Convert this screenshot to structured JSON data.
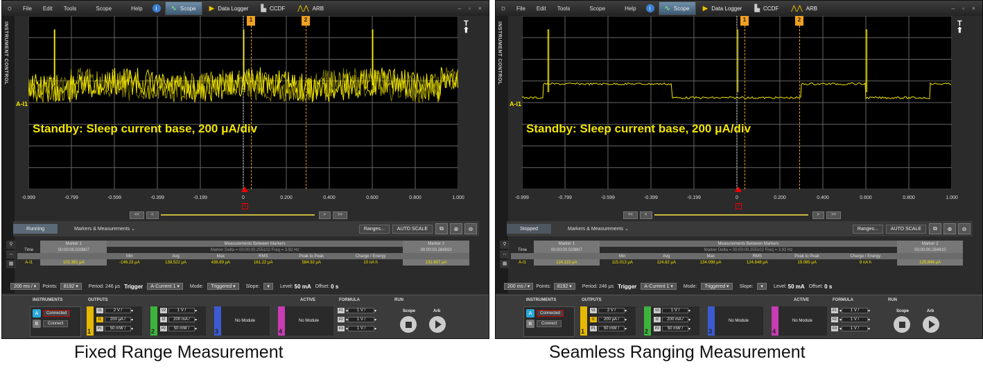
{
  "common": {
    "menu": [
      "File",
      "Edit",
      "Tools",
      "Scope",
      "Help"
    ],
    "tabs": [
      {
        "label": "Scope",
        "icon": "scope-icon"
      },
      {
        "label": "Data Logger",
        "icon": "datalogger-icon"
      },
      {
        "label": "CCDF",
        "icon": "ccdf-icon"
      },
      {
        "label": "ARB",
        "icon": "arb-icon"
      }
    ],
    "sidebar_label": "INSTRUMENT CONTROL",
    "trigger_arrow_label": "T",
    "channel_label": "A-I1",
    "annotation": "Standby:  Sleep current base, 200 μA/div",
    "x_ticks": [
      "-0.999",
      "-0.799",
      "-0.599",
      "-0.399",
      "-0.199",
      "0",
      "0.200",
      "0.400",
      "0.600",
      "0.800",
      "1.000"
    ],
    "marker1": "1",
    "marker2": "2",
    "nav_buttons": [
      "<<",
      "<",
      ">",
      ">>"
    ],
    "zero_mark": "0",
    "markers_label": "Markers & Measurements",
    "ranges_label": "Ranges...",
    "autoscale_label": "AUTO SCALE",
    "table": {
      "marker1_header": "Marker 1",
      "marker1_time": "00:00:00.029807",
      "between_header": "Measurements Between Markers",
      "delta_text": "Marker Delta = 00:00:00.255102   Freq = 3.92 Hz",
      "marker2_header": "Marker 2",
      "marker2_time": "00:00:00.284910",
      "time_label": "Time",
      "col_headers": [
        "Min",
        "Avg",
        "Max",
        "RMS",
        "Peak to Peak",
        "Charge / Energy"
      ],
      "row_label": "A-I1"
    },
    "controls": {
      "timebase": "200 ms /",
      "points_label": "Points:",
      "points": "8192",
      "period_label": "Period:",
      "period": "246 μs",
      "trigger_label": "Trigger",
      "trigger_source": "A-Current 1",
      "mode_label": "Mode:",
      "mode": "Triggered",
      "slope_label": "Slope:",
      "level_label": "Level:",
      "level": "50 mA",
      "offset_label": "Offset:",
      "offset": "0 s"
    },
    "bottom": {
      "instruments_title": "INSTRUMENTS",
      "outputs_title": "OUTPUTS",
      "active_title": "ACTIVE",
      "formula_title": "FORMULA",
      "run_title": "RUN",
      "inst_a": "A",
      "inst_a_status": "Connected",
      "inst_b": "B",
      "inst_b_status": "Connect",
      "out1": {
        "num": "1",
        "v_tag": "V1",
        "v_val": "2 V /",
        "i_tag": "I1",
        "i_val": "200 μA /",
        "p_tag": "P1",
        "p_val": "50 mW /"
      },
      "out2": {
        "num": "2",
        "v_tag": "V2",
        "v_val": "1 V /",
        "i_tag": "I2",
        "i_val": "200 mA /",
        "p_tag": "P2",
        "p_val": "50 mW /"
      },
      "out3": {
        "num": "3",
        "text": "No Module"
      },
      "out4": {
        "num": "4",
        "text": "No Module"
      },
      "formulas": [
        {
          "tag": "F1",
          "val": "1 V /"
        },
        {
          "tag": "F2",
          "val": "1 V /"
        },
        {
          "tag": "F3",
          "val": "1 V /"
        }
      ],
      "scope_label": "Scope",
      "arb_label": "Arb"
    },
    "colors": {
      "trace": "#f2e600",
      "marker": "#f0a020",
      "out1": "#e6b800",
      "out2": "#3cb43c",
      "out3": "#3c5ad2",
      "out4": "#c83cb4"
    }
  },
  "left": {
    "caption": "Fixed Range Measurement",
    "status": "Running",
    "values": [
      "102.361 μA",
      "-146.23 μA",
      "138.522 μA",
      "438.69 μA",
      "161.22 μA",
      "584.92 μA",
      "10 nA h",
      "131.607 μA"
    ]
  },
  "right": {
    "caption": "Seamless Ranging Measurement",
    "status": "Stopped",
    "values": [
      "124.115 μA",
      "115.013 μA",
      "124.82 μA",
      "134.098 μA",
      "124.848 μA",
      "19.085 μA",
      "9 nA h",
      "125.846 μA"
    ]
  }
}
